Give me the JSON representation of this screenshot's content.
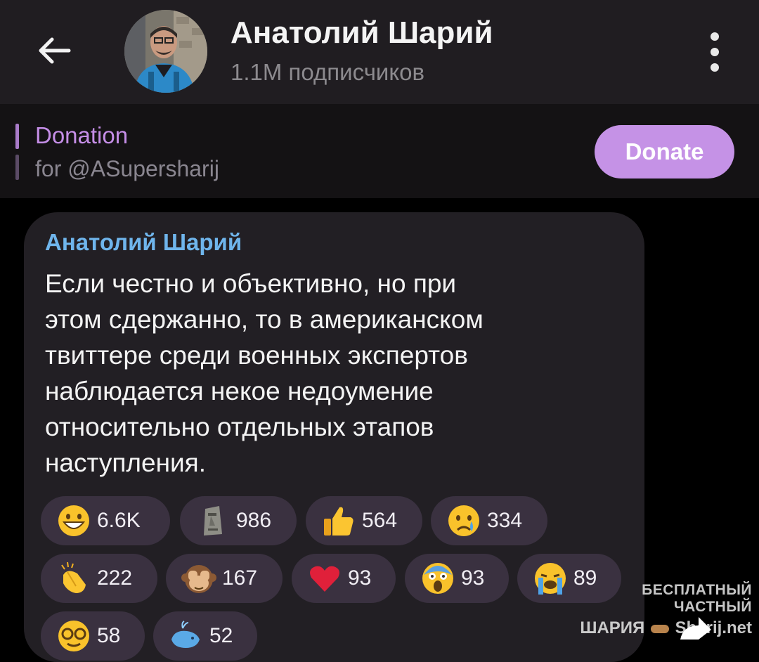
{
  "header": {
    "channel_name": "Анатолий Шарий",
    "subscribers": "1.1M подписчиков"
  },
  "pinned": {
    "title": "Donation",
    "subtitle": "for @ASupersharij",
    "button_label": "Donate"
  },
  "message": {
    "author": "Анатолий Шарий",
    "text": "Если честно и объективно, но при\nэтом сдержанно, то в американском\nтвиттере среди военных экспертов\nнаблюдается некое недоумение\nотносительно отдельных этапов\nнаступления."
  },
  "reactions": [
    {
      "emoji": "grinning-face",
      "count": "6.6K"
    },
    {
      "emoji": "moai",
      "count": "986"
    },
    {
      "emoji": "thumbs-up",
      "count": "564"
    },
    {
      "emoji": "crying-face",
      "count": "334"
    },
    {
      "emoji": "clapping-hands",
      "count": "222"
    },
    {
      "emoji": "see-no-evil-monkey",
      "count": "167"
    },
    {
      "emoji": "red-heart",
      "count": "93"
    },
    {
      "emoji": "screaming-face",
      "count": "93"
    },
    {
      "emoji": "loudly-crying-face",
      "count": "89"
    },
    {
      "emoji": "nerd-face",
      "count": "58"
    },
    {
      "emoji": "whale",
      "count": "52"
    }
  ],
  "watermark": {
    "line1": "БЕСПЛАТНЫЙ ЧАСТНЫЙ",
    "line2a": "ШАРИЯ",
    "line2b": "Sharij.net"
  },
  "colors": {
    "accent_purple": "#c592e6",
    "author_blue": "#6fb5ec",
    "bubble": "#221f24",
    "reaction_bg": "#3a3140"
  }
}
